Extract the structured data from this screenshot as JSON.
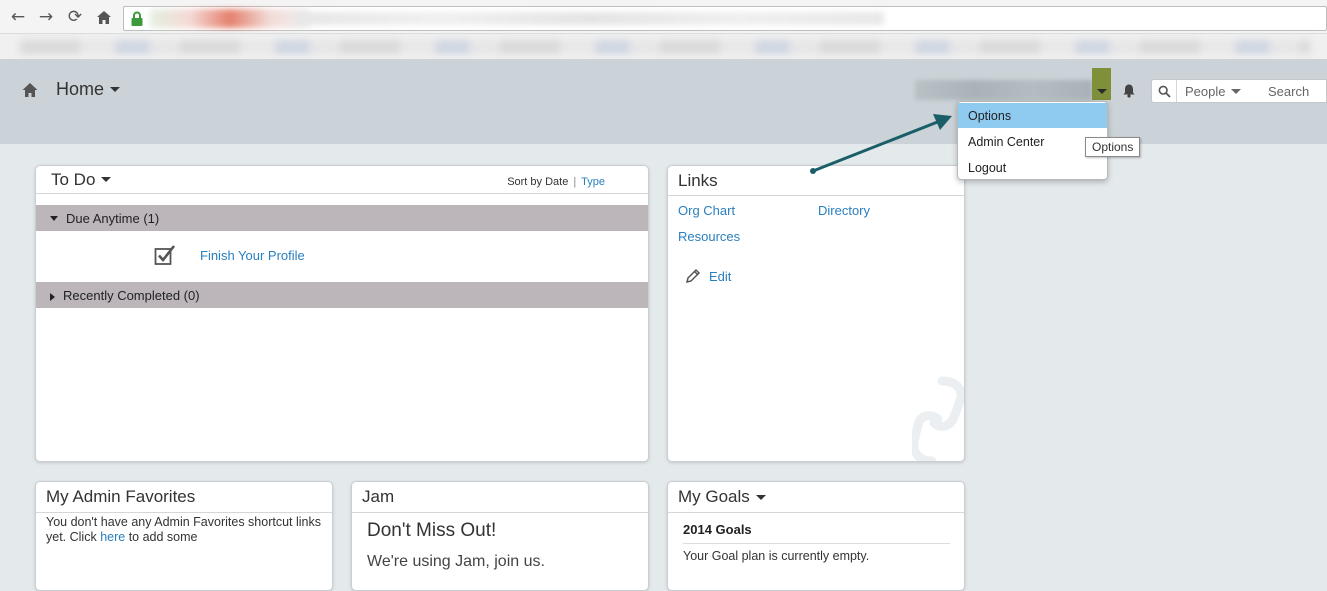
{
  "browser": {
    "back_glyph": "←",
    "forward_glyph": "→",
    "reload_glyph": "⟳",
    "icons": [
      "back-icon",
      "forward-icon",
      "reload-icon",
      "home-icon",
      "lock-icon"
    ]
  },
  "header": {
    "home_label": "Home",
    "icons": [
      "home-icon",
      "bell-icon",
      "search-icon",
      "chevron-down-icon"
    ],
    "toggle_color": "#7f8f3a",
    "search": {
      "scope_label": "People",
      "placeholder": "Search"
    }
  },
  "user_menu": {
    "items": [
      {
        "label": "Options",
        "active": true
      },
      {
        "label": "Admin Center",
        "active": false
      },
      {
        "label": "Logout",
        "active": false
      }
    ],
    "tooltip": "Options",
    "highlight_color": "#8fcaf0"
  },
  "annotation": {
    "arrow_color": "#1a5f67"
  },
  "todo": {
    "title": "To Do",
    "sort_prefix": "Sort by",
    "sort_date": "Date",
    "sort_separator": "|",
    "sort_type": "Type",
    "groups": [
      {
        "label": "Due Anytime (1)",
        "expanded": true
      },
      {
        "label": "Recently Completed (0)",
        "expanded": false
      }
    ],
    "item": "Finish Your Profile"
  },
  "links": {
    "title": "Links",
    "items": [
      "Org Chart",
      "Directory",
      "Resources"
    ],
    "edit_label": "Edit"
  },
  "admin_favorites": {
    "title": "My Admin Favorites",
    "text_before": "You don't have any Admin Favorites shortcut links yet. Click ",
    "link": "here",
    "text_after": " to add some"
  },
  "jam": {
    "title": "Jam",
    "headline": "Don't Miss Out!",
    "subtext": "We're using Jam, join us."
  },
  "goals": {
    "title": "My Goals",
    "plan_title": "2014 Goals",
    "empty_text": "Your Goal plan is currently empty."
  },
  "theme": {
    "link_color": "#2a7fbf",
    "header_bg": "#cbd3d8",
    "group_bar_bg": "#bcb6ba"
  }
}
